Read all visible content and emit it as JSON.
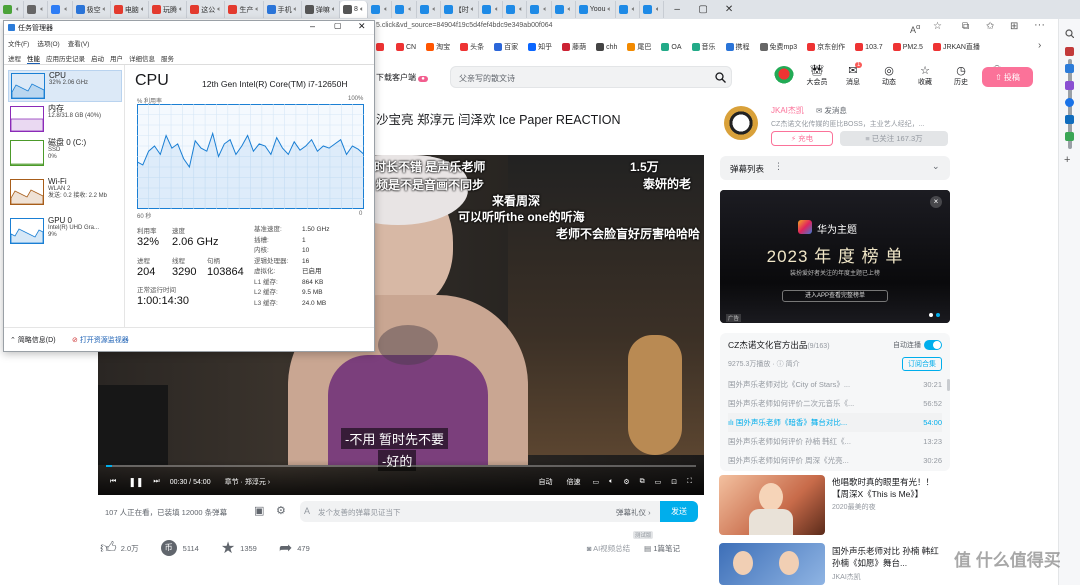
{
  "browser": {
    "tabs": [
      {
        "label": "",
        "color": "#4ba33a"
      },
      {
        "label": "",
        "color": "#666"
      },
      {
        "label": "",
        "color": "#2e7df5"
      },
      {
        "label": "极空",
        "color": "#2a74d8"
      },
      {
        "label": "电脑",
        "color": "#e33a2e"
      },
      {
        "label": "玩腾",
        "color": "#e33a2e"
      },
      {
        "label": "这公",
        "color": "#e33a2e"
      },
      {
        "label": "生产",
        "color": "#e33a2e"
      },
      {
        "label": "手机",
        "color": "#2a74d8"
      },
      {
        "label": "弹嘛",
        "color": "#555"
      },
      {
        "label": "8",
        "color": "#555"
      },
      {
        "label": "",
        "color": "#1e8ae6"
      },
      {
        "label": "",
        "color": "#1e8ae6"
      },
      {
        "label": "",
        "color": "#1e8ae6"
      },
      {
        "label": "【时",
        "color": "#1e8ae6"
      },
      {
        "label": "",
        "color": "#1e8ae6"
      },
      {
        "label": "",
        "color": "#1e8ae6"
      },
      {
        "label": "",
        "color": "#1e8ae6"
      },
      {
        "label": "",
        "color": "#1e8ae6"
      },
      {
        "label": "Yoou",
        "color": "#1e8ae6"
      },
      {
        "label": "",
        "color": "#1e8ae6"
      },
      {
        "label": "",
        "color": "#1e8ae6"
      }
    ],
    "url": "5.click&vd_source=84904f19c5d4fef4bdc9e349ab00f064",
    "bookmarks": [
      {
        "label": "",
        "color": "#e33"
      },
      {
        "label": "CN",
        "color": "#e33"
      },
      {
        "label": "淘宝",
        "color": "#f50"
      },
      {
        "label": "头条",
        "color": "#e33"
      },
      {
        "label": "百家",
        "color": "#2b66d9"
      },
      {
        "label": "知乎",
        "color": "#0a66ff"
      },
      {
        "label": "藤荫",
        "color": "#c23"
      },
      {
        "label": "chh",
        "color": "#444"
      },
      {
        "label": "尾巴",
        "color": "#f28a00"
      },
      {
        "label": "OA",
        "color": "#2a8"
      },
      {
        "label": "音乐",
        "color": "#2a8"
      },
      {
        "label": "携程",
        "color": "#2a74d8"
      },
      {
        "label": "免费mp3",
        "color": "#666"
      },
      {
        "label": "京东创作",
        "color": "#e33"
      },
      {
        "label": "103.7",
        "color": "#e33"
      },
      {
        "label": "PM2.5",
        "color": "#e33"
      },
      {
        "label": "JRKAN直播",
        "color": "#e33"
      }
    ]
  },
  "site": {
    "download_label": "下载客户端",
    "search_placeholder": "父亲写的散文诗",
    "nav": [
      "大会员",
      "消息",
      "动态",
      "收藏",
      "历史",
      "创作中心"
    ],
    "upload_label": "投稿",
    "msg_badge": "1"
  },
  "task_manager": {
    "title": "任务管理器",
    "menu": [
      "文件(F)",
      "选项(O)",
      "查看(V)"
    ],
    "tabs": [
      "进程",
      "性能",
      "应用历史记录",
      "启动",
      "用户",
      "详细信息",
      "服务"
    ],
    "side": [
      {
        "name": "CPU",
        "sub1": "32%  2.06 GHz",
        "sub2": "",
        "color": "#1a7fd4"
      },
      {
        "name": "内存",
        "sub1": "12.8/31.8 GB (40%)",
        "sub2": "",
        "color": "#8b2ab8"
      },
      {
        "name": "磁盘 0 (C:)",
        "sub1": "SSD",
        "sub2": "0%",
        "color": "#4c9a2a"
      },
      {
        "name": "Wi-Fi",
        "sub1": "WLAN 2",
        "sub2": "发送: 0.2 接收: 2.2 Mb",
        "color": "#a75d1a"
      },
      {
        "name": "GPU 0",
        "sub1": "Intel(R) UHD Gra...",
        "sub2": "9%",
        "color": "#1a7fd4"
      }
    ],
    "heading": "CPU",
    "model": "12th Gen Intel(R) Core(TM) i7-12650H",
    "graph_label": "% 利用率",
    "graph_max": "100%",
    "graph_x_left": "60 秒",
    "graph_x_right": "0",
    "graph_values": [
      45,
      42,
      55,
      60,
      52,
      70,
      58,
      62,
      48,
      40,
      65,
      58,
      55,
      72,
      50,
      62,
      66,
      52,
      60,
      70,
      55,
      62,
      60,
      52,
      68,
      58,
      52,
      64,
      56,
      60,
      66,
      55,
      60,
      58,
      62,
      66,
      52,
      60,
      57,
      52
    ],
    "stats": {
      "util_label": "利用率",
      "util": "32%",
      "speed_label": "速度",
      "speed": "2.06 GHz",
      "proc_label": "进程",
      "proc": "204",
      "threads_label": "线程",
      "threads": "3290",
      "handles_label": "句柄",
      "handles": "103864",
      "uptime_label": "正常运行时间",
      "uptime": "1:00:14:30"
    },
    "specs": [
      {
        "k": "基准速度:",
        "v": "1.50 GHz"
      },
      {
        "k": "插槽:",
        "v": "1"
      },
      {
        "k": "内核:",
        "v": "10"
      },
      {
        "k": "逻辑处理器:",
        "v": "16"
      },
      {
        "k": "虚拟化:",
        "v": "已启用"
      },
      {
        "k": "L1 缓存:",
        "v": "864 KB"
      },
      {
        "k": "L2 缓存:",
        "v": "9.5 MB"
      },
      {
        "k": "L3 缓存:",
        "v": "24.0 MB"
      }
    ],
    "less_details": "简略信息(D)",
    "open_monitor": "打开资源监视器"
  },
  "video": {
    "title": "沙宝亮 郑淳元 闫泽欢 Ice Paper REACTION",
    "danmaku": [
      "时长不错  是声乐老师",
      "频是不是音画不同步",
      "来看周深",
      "可以听听the one的听海",
      "老师不会脸盲好厉害哈哈哈",
      "1.5万",
      "泰妍的老"
    ],
    "subtitle1": "-不用 暂时先不要",
    "subtitle2": "-好的",
    "time": "00:30 / 54:00",
    "chapter": "章节 · 郑淳元 ›",
    "auto": "自动",
    "speed": "倍速",
    "progress": 0.01,
    "viewers": "107 人正在看，已装填 12000 条弹幕",
    "danmu_placeholder": "发个友善的弹幕见证当下",
    "etiquette": "弹幕礼仪 ›",
    "send": "发送",
    "likes": "2.0万",
    "coins": "5114",
    "favs": "1359",
    "shares": "479",
    "ai_summary": "AI视频总结",
    "ai_badge": "测试版",
    "notes": "1篇笔记"
  },
  "uploader": {
    "name": "JKAI杰凯",
    "msg": "发消息",
    "desc": "CZ杰诺文化传媒的匪比BOSS，主业艺人经纪，...",
    "charge": "充电",
    "followed": "已关注 167.3万"
  },
  "danmu_list_label": "弹幕列表",
  "ad": {
    "brand": "华为主题",
    "headline": "2023 年 度 榜 单",
    "sub": "装扮爱好者关注的年度主题已上榜",
    "cta": "进入APP查看完整榜单",
    "tag": "广告"
  },
  "playlist": {
    "title": "CZ杰诺文化官方出品",
    "count": "(9/163)",
    "autoplay": "自动连播",
    "plays": "9275.3万播放",
    "brief": "简介",
    "subscribe": "订阅合集",
    "items": [
      {
        "t": "国外声乐老师对比《City of Stars》...",
        "d": "30:21"
      },
      {
        "t": "国外声乐老师如何评价二次元音乐《...",
        "d": "56:52"
      },
      {
        "t": "国外声乐老师《暗香》舞台对比...",
        "d": "54:00"
      },
      {
        "t": "国外声乐老师如何评价 孙楠 韩红《...",
        "d": "13:23"
      },
      {
        "t": "国外声乐老师如何评价 周深《光亮...",
        "d": "30:26"
      }
    ]
  },
  "recs": [
    {
      "t1": "他唱歌时真的眼里有光！！",
      "t2": "【周深X《This is Me》】",
      "s": "2020最美的夜"
    },
    {
      "t1": "国外声乐老师对比 孙楠 韩红",
      "t2": "孙楠《如愿》舞台...",
      "s": "JKAI杰凯"
    }
  ],
  "watermark": "值 什么值得买"
}
